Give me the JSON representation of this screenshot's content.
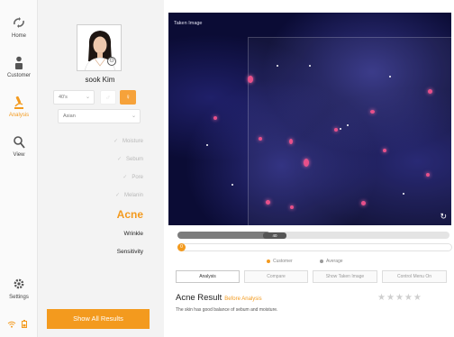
{
  "nav": {
    "items": [
      {
        "key": "home",
        "label": "Home",
        "icon": "home-icon",
        "active": false
      },
      {
        "key": "customer",
        "label": "Customer",
        "icon": "person-icon",
        "active": false
      },
      {
        "key": "analysis",
        "label": "Analysis",
        "icon": "microscope-icon",
        "active": true
      },
      {
        "key": "view",
        "label": "View",
        "icon": "search-icon",
        "active": false
      }
    ],
    "settings": {
      "label": "Settings",
      "icon": "gear-icon"
    },
    "status_icons": [
      "wifi-icon",
      "battery-icon"
    ]
  },
  "profile": {
    "username": "sook Kim",
    "age_select": "40's",
    "ethnicity_select": "Asian",
    "gender_male_icon": "male-icon",
    "gender_female_icon": "female-icon",
    "gender_selected": "female"
  },
  "attributes": [
    {
      "label": "Moisture",
      "state": "done"
    },
    {
      "label": "Sebum",
      "state": "done"
    },
    {
      "label": "Pore",
      "state": "done"
    },
    {
      "label": "Melanin",
      "state": "done"
    },
    {
      "label": "Acne",
      "state": "current"
    },
    {
      "label": "Wrinkle",
      "state": "pending"
    },
    {
      "label": "Sensitivity",
      "state": "pending"
    }
  ],
  "show_all_label": "Show All Results",
  "viewer": {
    "title": "Taken Image",
    "rotate_icon": "rotate-icon"
  },
  "sliders": {
    "average_label": "40",
    "average_level": 0.34,
    "customer_label": "0",
    "customer_level": 0.0
  },
  "legend": {
    "customer": "Customer",
    "average": "Average",
    "customer_color": "#f39a1e",
    "average_color": "#9a9a9a"
  },
  "tabs": [
    {
      "label": "Analysis",
      "active": true
    },
    {
      "label": "Compare",
      "active": false
    },
    {
      "label": "Show Taken Image",
      "active": false
    },
    {
      "label": "Control Menu On",
      "active": false
    }
  ],
  "result": {
    "title": "Acne Result",
    "before_label": "Before Analysis",
    "description": "The skin has good balance of sebum and moisture.",
    "rating": 0,
    "rating_max": 5
  },
  "colors": {
    "accent": "#f39a1e",
    "panel": "#f3f3f3"
  }
}
